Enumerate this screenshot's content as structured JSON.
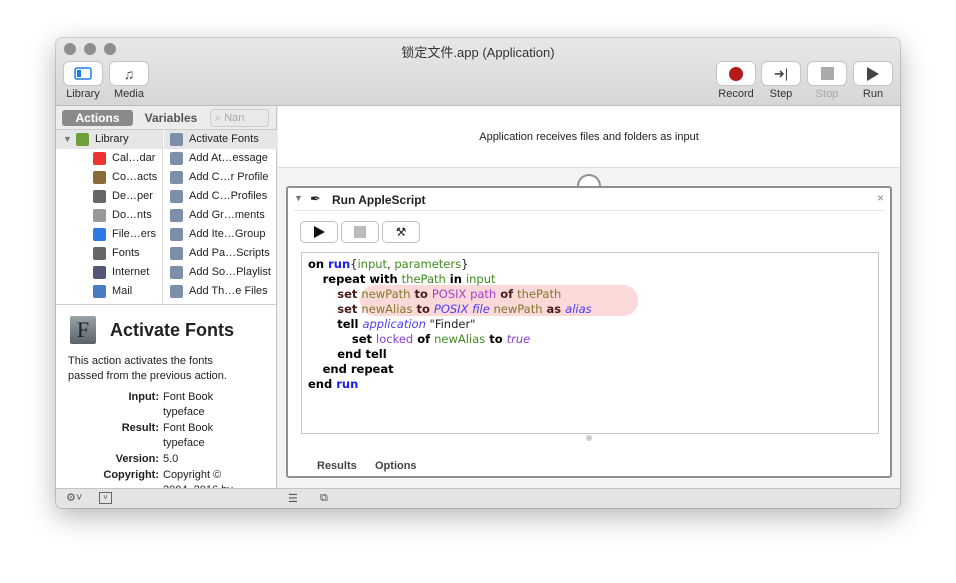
{
  "window": {
    "title": "锁定文件.app (Application)"
  },
  "toolbar": {
    "library": "Library",
    "media": "Media",
    "record": "Record",
    "step": "Step",
    "stop": "Stop",
    "run": "Run",
    "record_color": "#b31b1b"
  },
  "library_tabs": {
    "actions": "Actions",
    "variables": "Variables",
    "search_placeholder": "Nan"
  },
  "categories": [
    {
      "label": "Library",
      "icon": "library-icon"
    },
    {
      "label": "Cal…dar",
      "icon": "calendar-icon"
    },
    {
      "label": "Co…acts",
      "icon": "contacts-icon"
    },
    {
      "label": "De…per",
      "icon": "developer-icon"
    },
    {
      "label": "Do…nts",
      "icon": "documents-icon"
    },
    {
      "label": "File…ers",
      "icon": "finder-icon"
    },
    {
      "label": "Fonts",
      "icon": "fonts-icon"
    },
    {
      "label": "Internet",
      "icon": "internet-icon"
    },
    {
      "label": "Mail",
      "icon": "mail-icon"
    }
  ],
  "actions": [
    {
      "label": "Activate Fonts"
    },
    {
      "label": "Add At…essage"
    },
    {
      "label": "Add C…r Profile"
    },
    {
      "label": "Add C…Profiles"
    },
    {
      "label": "Add Gr…ments"
    },
    {
      "label": "Add Ite…Group"
    },
    {
      "label": "Add Pa…Scripts"
    },
    {
      "label": "Add So…Playlist"
    },
    {
      "label": "Add Th…e Files"
    }
  ],
  "description": {
    "title": "Activate Fonts",
    "text": "This action activates the fonts passed from the previous action.",
    "fields": [
      {
        "label": "Input:",
        "value": "Font Book typeface"
      },
      {
        "label": "Result:",
        "value": "Font Book typeface"
      },
      {
        "label": "Version:",
        "value": "5.0"
      },
      {
        "label": "Copyright:",
        "value": "Copyright © 2004–2016 by"
      }
    ]
  },
  "workflow": {
    "input_note": "Application receives files and folders as input"
  },
  "action": {
    "title": "Run AppleScript",
    "results_tab": "Results",
    "options_tab": "Options",
    "code": [
      [
        [
          "k",
          "on "
        ],
        [
          "blue",
          "run"
        ],
        [
          "",
          "{"
        ],
        [
          "v",
          "input"
        ],
        [
          "",
          ", "
        ],
        [
          "v",
          "parameters"
        ],
        [
          "",
          "}"
        ]
      ],
      [
        [
          "",
          "    "
        ],
        [
          "k",
          "repeat with "
        ],
        [
          "v",
          "thePath"
        ],
        [
          "k",
          " in "
        ],
        [
          "v",
          "input"
        ]
      ],
      [
        [
          "",
          "        "
        ],
        [
          "kh",
          "set "
        ],
        [
          "vh",
          "newPath"
        ],
        [
          "kh",
          " to "
        ],
        [
          "pp",
          "POSIX path"
        ],
        [
          "kh",
          " of "
        ],
        [
          "vh",
          "thePath"
        ]
      ],
      [
        [
          "",
          "        "
        ],
        [
          "kh",
          "set "
        ],
        [
          "vh",
          "newAlias"
        ],
        [
          "kh",
          " to "
        ],
        [
          "it",
          "POSIX file"
        ],
        [
          "vh",
          " newPath"
        ],
        [
          "kh",
          " as "
        ],
        [
          "it",
          "alias"
        ]
      ],
      [
        [
          "",
          "        "
        ],
        [
          "k",
          "tell "
        ],
        [
          "it",
          "application"
        ],
        [
          "",
          " \"Finder\""
        ]
      ],
      [
        [
          "",
          "            "
        ],
        [
          "k",
          "set "
        ],
        [
          "pl",
          "locked"
        ],
        [
          "k",
          " of "
        ],
        [
          "v",
          "newAlias"
        ],
        [
          "k",
          " to "
        ],
        [
          "pi",
          "true"
        ]
      ],
      [
        [
          "",
          "        "
        ],
        [
          "k",
          "end tell"
        ]
      ],
      [
        [
          "",
          "    "
        ],
        [
          "k",
          "end repeat"
        ]
      ],
      [
        [
          "k",
          "end "
        ],
        [
          "blue",
          "run"
        ]
      ]
    ]
  }
}
